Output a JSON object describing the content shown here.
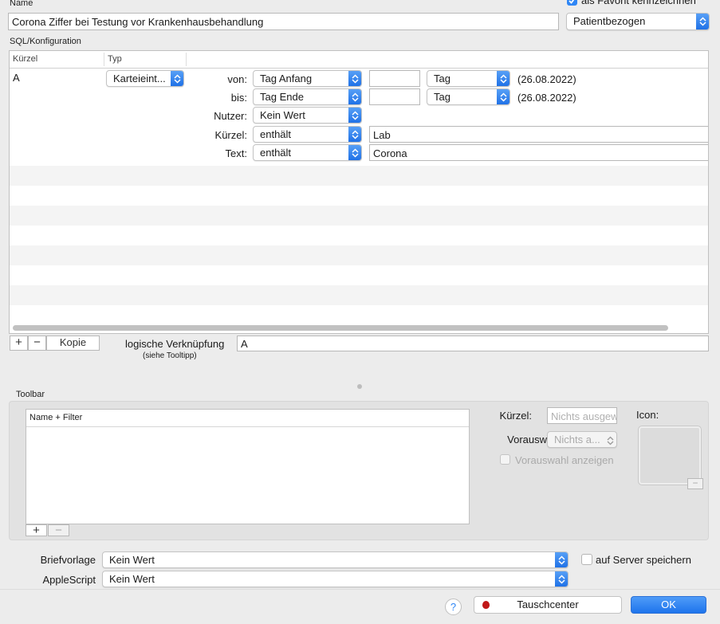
{
  "header": {
    "name_label": "Name",
    "name_value": "Corona Ziffer bei Testung vor Krankenhausbehandlung",
    "favorite_label": "als Favorit kennzeichnen",
    "scope_value": "Patientbezogen"
  },
  "sql": {
    "section_label": "SQL/Konfiguration",
    "columns": [
      "Kürzel",
      "Typ"
    ],
    "row_kuerzel": "A",
    "row_typ": "Karteieint...",
    "von_label": "von:",
    "von_select": "Tag Anfang",
    "von_unit": "Tag",
    "von_date": "(26.08.2022)",
    "bis_label": "bis:",
    "bis_select": "Tag Ende",
    "bis_unit": "Tag",
    "bis_date": "(26.08.2022)",
    "nutzer_label": "Nutzer:",
    "nutzer_select": "Kein Wert",
    "kuerzel_label": "Kürzel:",
    "kuerzel_op": "enthält",
    "kuerzel_value": "Lab",
    "text_label": "Text:",
    "text_op": "enthält",
    "text_value": "Corona"
  },
  "footer_bar": {
    "add": "+",
    "remove": "−",
    "copy": "Kopie",
    "logic_label": "logische Verknüpfung",
    "logic_hint": "(siehe Tooltipp)",
    "logic_value": "A"
  },
  "toolbar": {
    "section_label": "Toolbar",
    "list_header": "Name + Filter",
    "add": "+",
    "remove": "−",
    "kuerzel_label": "Kürzel:",
    "kuerzel_placeholder": "Nichts ausgew",
    "vorauswahl_label": "Vorauswahl:",
    "vorauswahl_value": "Nichts a...",
    "vorauswahl_checkbox": "Vorauswahl anzeigen",
    "icon_label": "Icon:",
    "icon_remove": "−"
  },
  "bottom": {
    "briefvorlage_label": "Briefvorlage",
    "briefvorlage_value": "Kein Wert",
    "server_checkbox": "auf Server speichern",
    "applescript_label": "AppleScript",
    "applescript_value": "Kein Wert",
    "help": "?",
    "tauschcenter": "Tauschcenter",
    "ok": "OK"
  },
  "colors": {
    "accent": "#1d6fe6",
    "ok_button": "#2f86f5"
  }
}
